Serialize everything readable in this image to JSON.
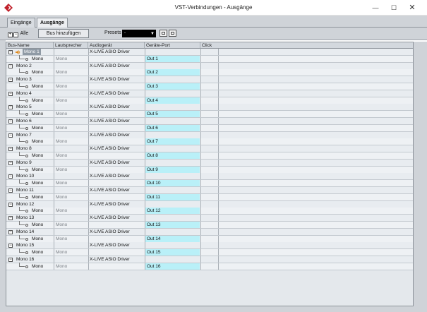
{
  "window": {
    "title": "VST-Verbindungen - Ausgänge",
    "minimize": "—",
    "maximize": "☐",
    "close": "✕"
  },
  "tabs": [
    {
      "label": "Eingänge",
      "active": false
    },
    {
      "label": "Ausgänge",
      "active": true
    }
  ],
  "toolbar": {
    "all_label": "Alle",
    "bus_add_label": "Bus hinzufügen",
    "presets_label": "Presets",
    "presets_value": "-"
  },
  "columns": [
    "Bus-Name",
    "Lautsprecher",
    "Audiogerät",
    "Geräte-Port",
    "Click"
  ],
  "rows": [
    {
      "bus": "Mono 1",
      "channel": "Mono",
      "speaker": "Mono",
      "device": "X-LIVE ASIO Driver",
      "port": "Out 1"
    },
    {
      "bus": "Mono 2",
      "channel": "Mono",
      "speaker": "Mono",
      "device": "X-LIVE ASIO Driver",
      "port": "Out 2"
    },
    {
      "bus": "Mono 3",
      "channel": "Mono",
      "speaker": "Mono",
      "device": "X-LIVE ASIO Driver",
      "port": "Out 3"
    },
    {
      "bus": "Mono 4",
      "channel": "Mono",
      "speaker": "Mono",
      "device": "X-LIVE ASIO Driver",
      "port": "Out 4"
    },
    {
      "bus": "Mono 5",
      "channel": "Mono",
      "speaker": "Mono",
      "device": "X-LIVE ASIO Driver",
      "port": "Out 5"
    },
    {
      "bus": "Mono 6",
      "channel": "Mono",
      "speaker": "Mono",
      "device": "X-LIVE ASIO Driver",
      "port": "Out 6"
    },
    {
      "bus": "Mono 7",
      "channel": "Mono",
      "speaker": "Mono",
      "device": "X-LIVE ASIO Driver",
      "port": "Out 7"
    },
    {
      "bus": "Mono 8",
      "channel": "Mono",
      "speaker": "Mono",
      "device": "X-LIVE ASIO Driver",
      "port": "Out 8"
    },
    {
      "bus": "Mono 9",
      "channel": "Mono",
      "speaker": "Mono",
      "device": "X-LIVE ASIO Driver",
      "port": "Out 9"
    },
    {
      "bus": "Mono 10",
      "channel": "Mono",
      "speaker": "Mono",
      "device": "X-LIVE ASIO Driver",
      "port": "Out 10"
    },
    {
      "bus": "Mono 11",
      "channel": "Mono",
      "speaker": "Mono",
      "device": "X-LIVE ASIO Driver",
      "port": "Out 11"
    },
    {
      "bus": "Mono 12",
      "channel": "Mono",
      "speaker": "Mono",
      "device": "X-LIVE ASIO Driver",
      "port": "Out 12"
    },
    {
      "bus": "Mono 13",
      "channel": "Mono",
      "speaker": "Mono",
      "device": "X-LIVE ASIO Driver",
      "port": "Out 13"
    },
    {
      "bus": "Mono 14",
      "channel": "Mono",
      "speaker": "Mono",
      "device": "X-LIVE ASIO Driver",
      "port": "Out 14"
    },
    {
      "bus": "Mono 15",
      "channel": "Mono",
      "speaker": "Mono",
      "device": "X-LIVE ASIO Driver",
      "port": "Out 15"
    },
    {
      "bus": "Mono 16",
      "channel": "Mono",
      "speaker": "Mono",
      "device": "X-LIVE ASIO Driver",
      "port": "Out 16"
    }
  ],
  "selected_bus": "Mono 1",
  "colors": {
    "port_cell": "#b9f0f8",
    "selection": "#8f9aa5",
    "logo": "#c0202a"
  }
}
